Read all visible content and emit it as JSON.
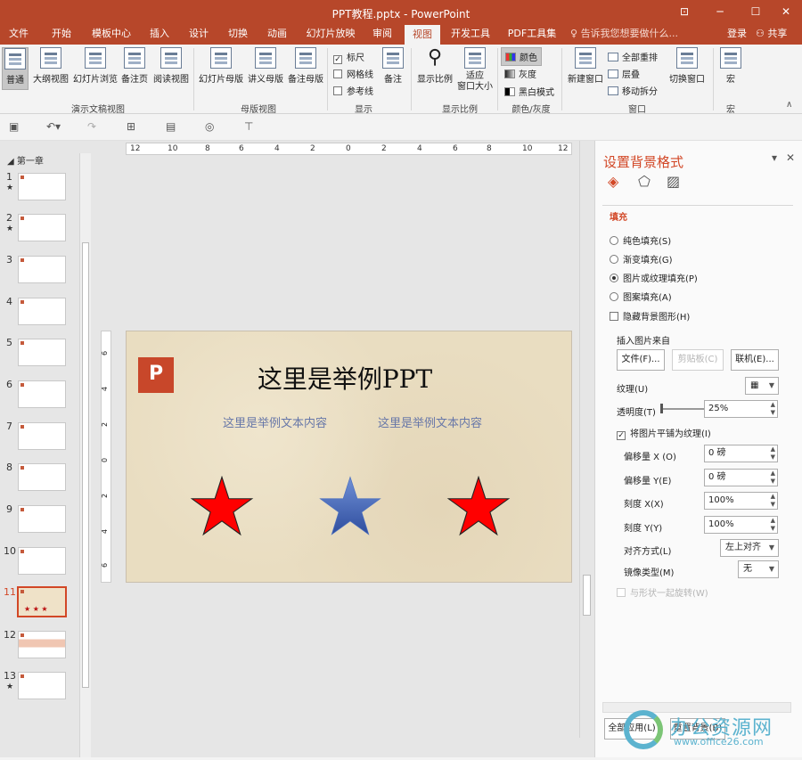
{
  "window": {
    "title": "PPT教程.pptx - PowerPoint",
    "restore_icon": "ribbon-display-icon",
    "minimize": "─",
    "maximize": "☐",
    "close": "✕"
  },
  "tabs": [
    {
      "label": "文件"
    },
    {
      "label": "开始"
    },
    {
      "label": "模板中心"
    },
    {
      "label": "插入"
    },
    {
      "label": "设计"
    },
    {
      "label": "切换"
    },
    {
      "label": "动画"
    },
    {
      "label": "幻灯片放映"
    },
    {
      "label": "审阅"
    },
    {
      "label": "视图",
      "active": true
    },
    {
      "label": "开发工具"
    },
    {
      "label": "PDF工具集"
    }
  ],
  "tell_me": "告诉我您想要做什么...",
  "account": {
    "login": "登录",
    "share": "共享"
  },
  "ribbon": {
    "presentation_views": {
      "group": "演示文稿视图",
      "normal": "普通",
      "outline": "大纲视图",
      "sorter": "幻灯片浏览",
      "notes_page": "备注页",
      "reading": "阅读视图"
    },
    "master_views": {
      "group": "母版视图",
      "slide_master": "幻灯片母版",
      "handout_master": "讲义母版",
      "notes_master": "备注母版"
    },
    "show": {
      "group": "显示",
      "ruler": "标尺",
      "ruler_checked": true,
      "gridlines": "网格线",
      "guides": "参考线",
      "notes": "备注"
    },
    "zoom": {
      "group": "显示比例",
      "zoom": "显示比例",
      "fit": "适应\n窗口大小"
    },
    "color": {
      "group": "颜色/灰度",
      "color": "颜色",
      "grayscale": "灰度",
      "bw": "黑白模式"
    },
    "window": {
      "group": "窗口",
      "new_window": "新建窗口",
      "arrange_all": "全部重排",
      "cascade": "层叠",
      "move_split": "移动拆分",
      "switch": "切换窗口"
    },
    "macros": {
      "group": "宏",
      "macros": "宏"
    }
  },
  "thumbnails": {
    "section": "第一章",
    "slides": [
      {
        "num": "1",
        "star": "★"
      },
      {
        "num": "2",
        "star": "★"
      },
      {
        "num": "3",
        "star": ""
      },
      {
        "num": "4",
        "star": ""
      },
      {
        "num": "5",
        "star": ""
      },
      {
        "num": "6",
        "star": ""
      },
      {
        "num": "7",
        "star": ""
      },
      {
        "num": "8",
        "star": ""
      },
      {
        "num": "9",
        "star": ""
      },
      {
        "num": "10",
        "star": ""
      },
      {
        "num": "11",
        "star": "",
        "current": true
      },
      {
        "num": "12",
        "star": ""
      },
      {
        "num": "13",
        "star": "★"
      }
    ]
  },
  "ruler": {
    "h": [
      "12",
      "10",
      "8",
      "6",
      "4",
      "2",
      "0",
      "2",
      "4",
      "6",
      "8",
      "10",
      "12"
    ],
    "v": [
      "6",
      "4",
      "2",
      "0",
      "2",
      "4",
      "6"
    ]
  },
  "slide": {
    "logo": "P",
    "title": "这里是举例PPT",
    "text_left": "这里是举例文本内容",
    "text_right": "这里是举例文本内容",
    "stars": [
      {
        "color": "#ff0000"
      },
      {
        "color": "#4a6fc0"
      },
      {
        "color": "#ff0000"
      }
    ]
  },
  "panel": {
    "title": "设置背景格式",
    "fill_header": "填充",
    "options": [
      {
        "label": "纯色填充(S)",
        "selected": false
      },
      {
        "label": "渐变填充(G)",
        "selected": false
      },
      {
        "label": "图片或纹理填充(P)",
        "selected": true
      },
      {
        "label": "图案填充(A)",
        "selected": false
      }
    ],
    "hide_bg": "隐藏背景图形(H)",
    "insert_from": "插入图片来自",
    "file_btn": "文件(F)...",
    "clipboard_btn": "剪贴板(C)",
    "online_btn": "联机(E)...",
    "texture": "纹理(U)",
    "transparency": "透明度(T)",
    "transparency_value": "25%",
    "tile": "将图片平铺为纹理(I)",
    "tile_checked": true,
    "offset_x": "偏移量 X (O)",
    "offset_x_value": "0 磅",
    "offset_y": "偏移量 Y(E)",
    "offset_y_value": "0 磅",
    "scale_x": "刻度 X(X)",
    "scale_x_value": "100%",
    "scale_y": "刻度 Y(Y)",
    "scale_y_value": "100%",
    "align": "对齐方式(L)",
    "align_value": "左上对齐",
    "mirror": "镜像类型(M)",
    "mirror_value": "无",
    "rotate": "与形状一起旋转(W)",
    "apply_all": "全部应用(L)",
    "reset": "重置背景(B)"
  },
  "watermark": {
    "name": "办公资源网",
    "url": "www.office26.com"
  }
}
